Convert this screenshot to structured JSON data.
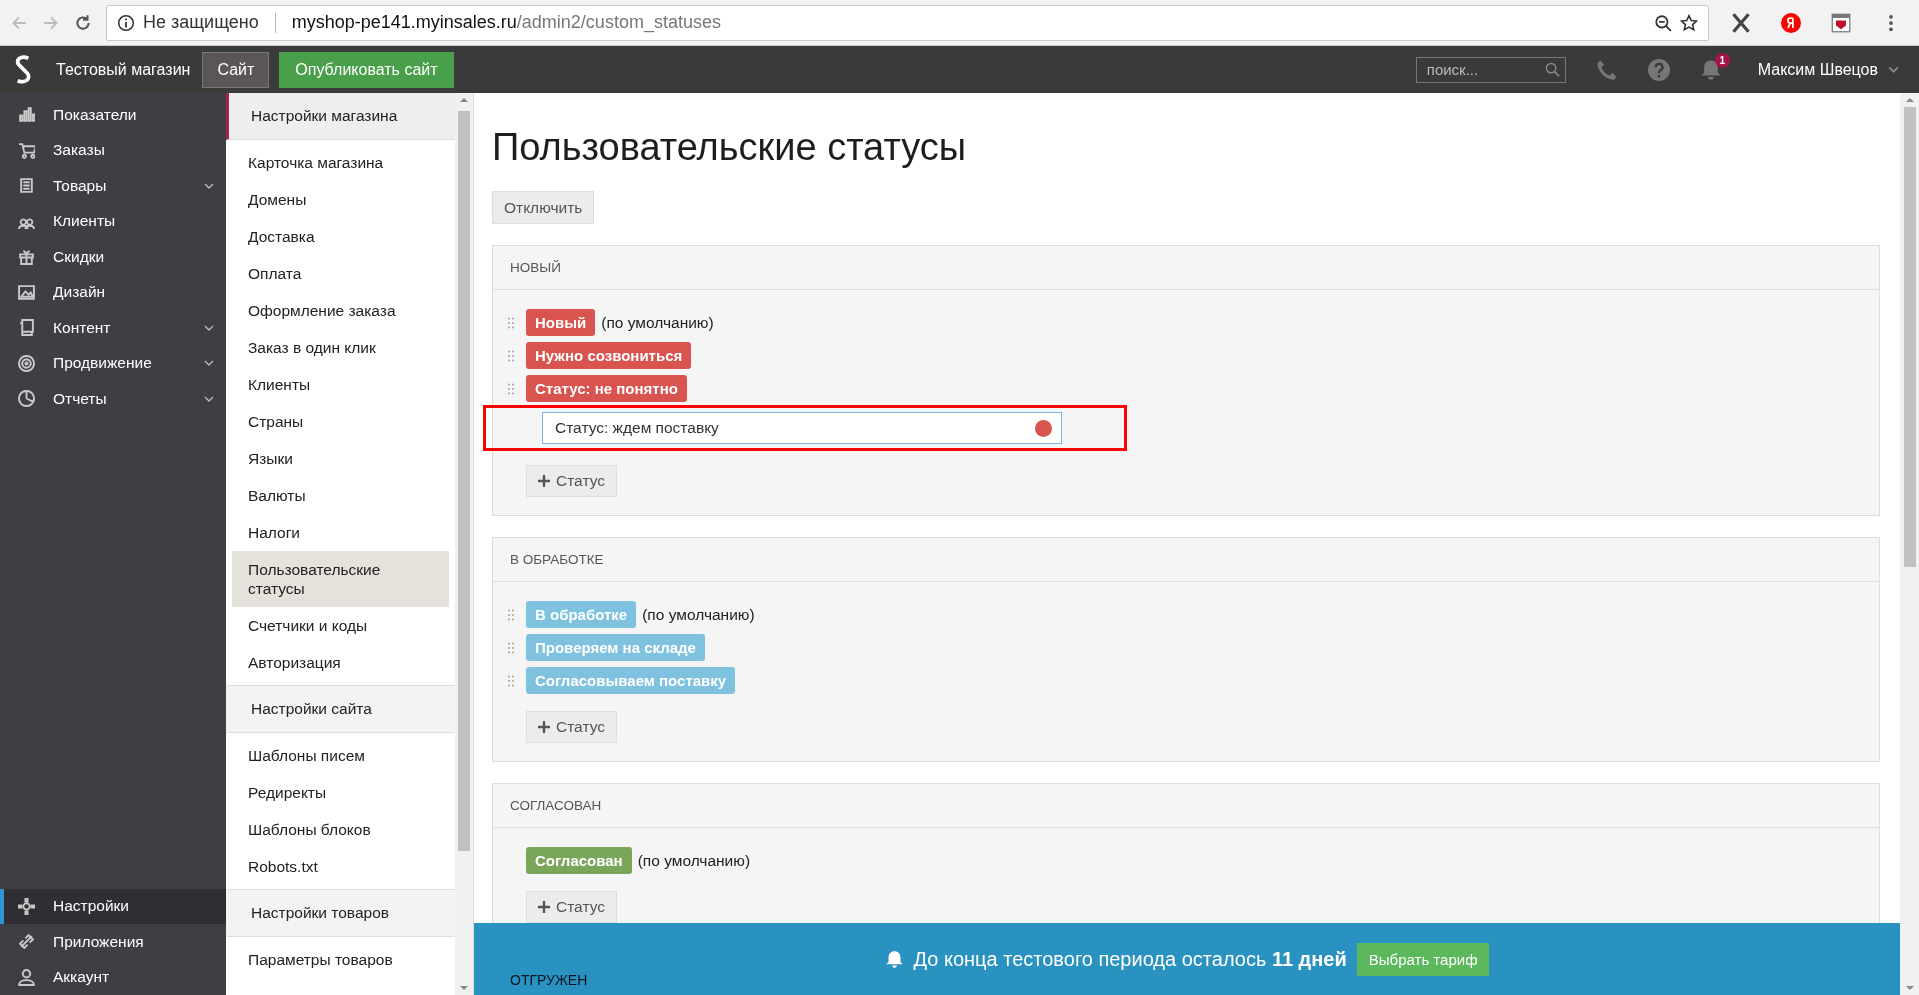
{
  "browser": {
    "security": "Не защищено",
    "host": "myshop-pe141.myinsales.ru",
    "path": "/admin2/custom_statuses"
  },
  "topbar": {
    "shop_name": "Тестовый магазин",
    "site_button": "Сайт",
    "publish_button": "Опубликовать сайт",
    "search_placeholder": "поиск...",
    "notification_count": "1",
    "user": "Максим Швецов"
  },
  "main_nav": {
    "top": [
      {
        "label": "Показатели",
        "expandable": false,
        "selected": false
      },
      {
        "label": "Заказы",
        "expandable": false,
        "selected": false
      },
      {
        "label": "Товары",
        "expandable": true,
        "selected": false
      },
      {
        "label": "Клиенты",
        "expandable": false,
        "selected": false
      },
      {
        "label": "Скидки",
        "expandable": false,
        "selected": false
      },
      {
        "label": "Дизайн",
        "expandable": false,
        "selected": false
      },
      {
        "label": "Контент",
        "expandable": true,
        "selected": false
      },
      {
        "label": "Продвижение",
        "expandable": true,
        "selected": false
      },
      {
        "label": "Отчеты",
        "expandable": true,
        "selected": false
      }
    ],
    "bottom": [
      {
        "label": "Настройки",
        "expandable": false,
        "selected": true
      },
      {
        "label": "Приложения",
        "expandable": false,
        "selected": false
      },
      {
        "label": "Аккаунт",
        "expandable": false,
        "selected": false
      }
    ]
  },
  "sub_nav": [
    {
      "title": "Настройки магазина",
      "selected": true,
      "items": [
        {
          "label": "Карточка магазина",
          "selected": false
        },
        {
          "label": "Домены",
          "selected": false
        },
        {
          "label": "Доставка",
          "selected": false
        },
        {
          "label": "Оплата",
          "selected": false
        },
        {
          "label": "Оформление заказа",
          "selected": false
        },
        {
          "label": "Заказ в один клик",
          "selected": false
        },
        {
          "label": "Клиенты",
          "selected": false
        },
        {
          "label": "Страны",
          "selected": false
        },
        {
          "label": "Языки",
          "selected": false
        },
        {
          "label": "Валюты",
          "selected": false
        },
        {
          "label": "Налоги",
          "selected": false
        },
        {
          "label": "Пользовательские статусы",
          "selected": true
        },
        {
          "label": "Счетчики и коды",
          "selected": false
        },
        {
          "label": "Авторизация",
          "selected": false
        }
      ]
    },
    {
      "title": "Настройки сайта",
      "selected": false,
      "items": [
        {
          "label": "Шаблоны писем",
          "selected": false
        },
        {
          "label": "Редиректы",
          "selected": false
        },
        {
          "label": "Шаблоны блоков",
          "selected": false
        },
        {
          "label": "Robots.txt",
          "selected": false
        }
      ]
    },
    {
      "title": "Настройки товаров",
      "selected": false,
      "items": [
        {
          "label": "Параметры товаров",
          "selected": false
        }
      ]
    }
  ],
  "page": {
    "title": "Пользовательские статусы",
    "disable_button": "Отключить"
  },
  "groups": [
    {
      "title": "НОВЫЙ",
      "color": "#d9534f",
      "statuses": [
        {
          "label": "Новый",
          "note": "(по умолчанию)",
          "draggable": true
        },
        {
          "label": "Нужно созвониться",
          "draggable": true
        },
        {
          "label": "Статус: не понятно",
          "draggable": true
        }
      ],
      "editor": {
        "value": "Статус: ждем поставку",
        "highlighted": true
      },
      "add_button": "Статус"
    },
    {
      "title": "В ОБРАБОТКЕ",
      "color": "#7fc2e0",
      "statuses": [
        {
          "label": "В обработке",
          "note": "(по умолчанию)",
          "draggable": true
        },
        {
          "label": "Проверяем на складе",
          "draggable": true
        },
        {
          "label": "Согласовываем поставку",
          "draggable": true
        }
      ],
      "add_button": "Статус"
    },
    {
      "title": "СОГЛАСОВАН",
      "color": "#7aa65a",
      "statuses": [
        {
          "label": "Согласован",
          "note": "(по умолчанию)",
          "draggable": false
        }
      ],
      "add_button": "Статус"
    },
    {
      "title": "ОТГРУЖЕН"
    }
  ],
  "banner": {
    "text": "До конца тестового периода осталось **11 дней**",
    "button": "Выбрать тариф"
  }
}
